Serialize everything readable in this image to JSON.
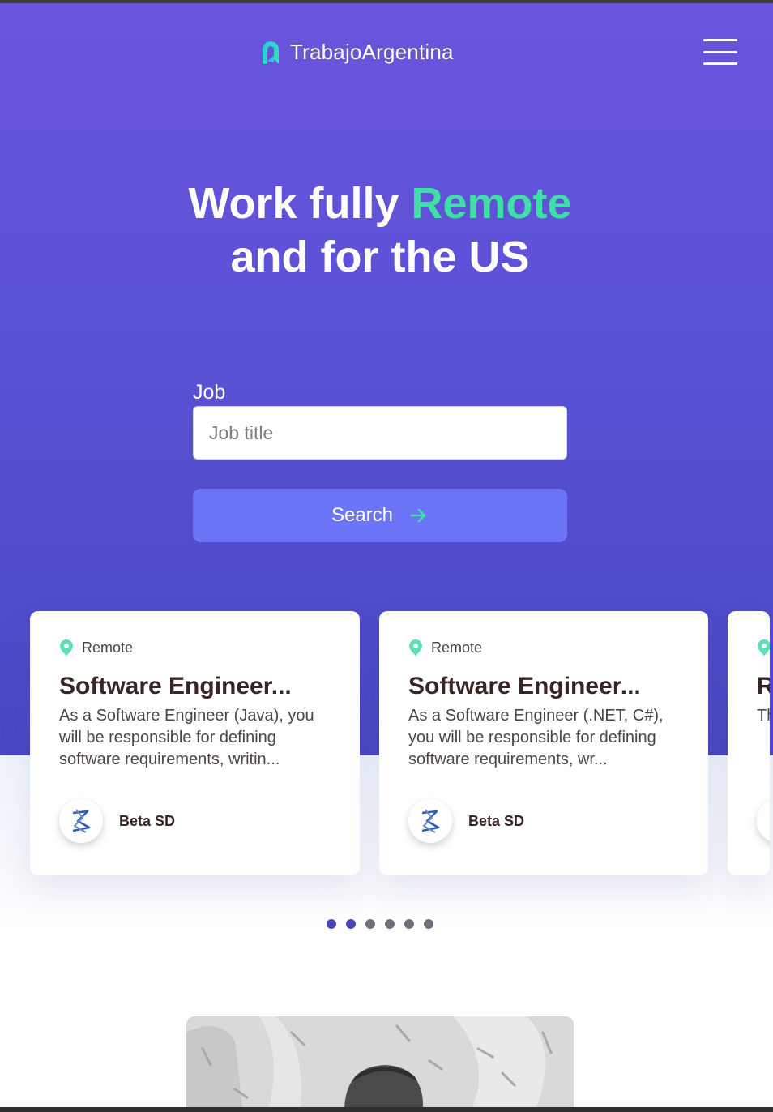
{
  "header": {
    "brand": "TrabajoArgentina",
    "brand_colors": {
      "mark_start": "#27c8e8",
      "mark_end": "#3ee0a6"
    },
    "menu_icon": "hamburger-menu-icon"
  },
  "hero": {
    "headline_part1": "Work fully ",
    "headline_accent": "Remote",
    "headline_line2": "and for the US",
    "accent_color": "#3ee0a6",
    "background_color": "#5a52d6"
  },
  "search": {
    "label": "Job",
    "placeholder": "Job title",
    "value": "",
    "button_label": "Search",
    "button_color": "#6c75f7",
    "button_icon": "arrow-right-icon"
  },
  "jobs": [
    {
      "location": "Remote",
      "title": "Software Engineer...",
      "description": "As a Software Engineer (Java), you will be responsible for defining software requirements, writin...",
      "company": "Beta SD"
    },
    {
      "location": "Remote",
      "title": "Software Engineer...",
      "description": "As a Software Engineer (.NET, C#), you will be responsible for defining software requirements, wr...",
      "company": "Beta SD"
    },
    {
      "location": "",
      "title": "R",
      "description": "Th kn Ra",
      "company": ""
    }
  ],
  "carousel": {
    "dot_count": 6,
    "active_dots": [
      0,
      1
    ]
  }
}
